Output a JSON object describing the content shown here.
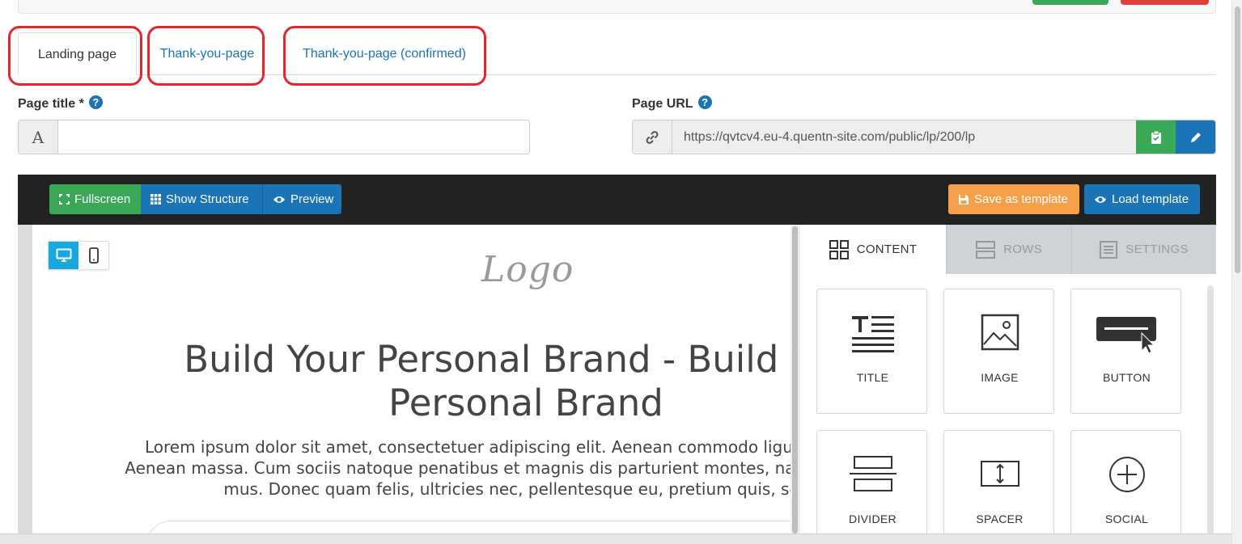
{
  "tabs": [
    {
      "label": "Landing page"
    },
    {
      "label": "Thank-you-page"
    },
    {
      "label": "Thank-you-page (confirmed)"
    }
  ],
  "form": {
    "page_title_label": "Page title *",
    "page_title_value": "",
    "page_title_addon": "A",
    "page_url_label": "Page URL",
    "page_url_value": "https://qvtcv4.eu-4.quentn-site.com/public/lp/200/lp",
    "help": "?"
  },
  "toolbar": {
    "fullscreen": "Fullscreen",
    "show_structure": "Show Structure",
    "preview": "Preview",
    "save_template": "Save as template",
    "load_template": "Load template"
  },
  "canvas": {
    "logo": "Logo",
    "headline": "Build Your Personal Brand - Build Your Personal Brand",
    "body_lines": [
      "Lorem ipsum dolor sit amet, consectetuer adipiscing elit. Aenean commodo ligula eget dolor.",
      "Aenean massa. Cum sociis natoque penatibus et magnis dis parturient montes, nascetur ridiculus",
      "mus. Donec quam felis, ultricies nec, pellentesque eu, pretium quis, sem."
    ]
  },
  "panel": {
    "tabs": [
      {
        "label": "CONTENT",
        "icon": "grid-icon"
      },
      {
        "label": "ROWS",
        "icon": "rows-icon"
      },
      {
        "label": "SETTINGS",
        "icon": "settings-icon"
      }
    ],
    "tiles": [
      {
        "label": "TITLE",
        "icon": "title-icon"
      },
      {
        "label": "IMAGE",
        "icon": "image-icon"
      },
      {
        "label": "BUTTON",
        "icon": "button-icon"
      },
      {
        "label": "DIVIDER",
        "icon": "divider-icon"
      },
      {
        "label": "SPACER",
        "icon": "spacer-icon"
      },
      {
        "label": "SOCIAL",
        "icon": "social-icon"
      }
    ]
  },
  "colors": {
    "highlight": "#e5252b",
    "link": "#1a74b5",
    "green": "#3aa856",
    "orange": "#f7a04a",
    "device_active": "#18a8e0"
  }
}
